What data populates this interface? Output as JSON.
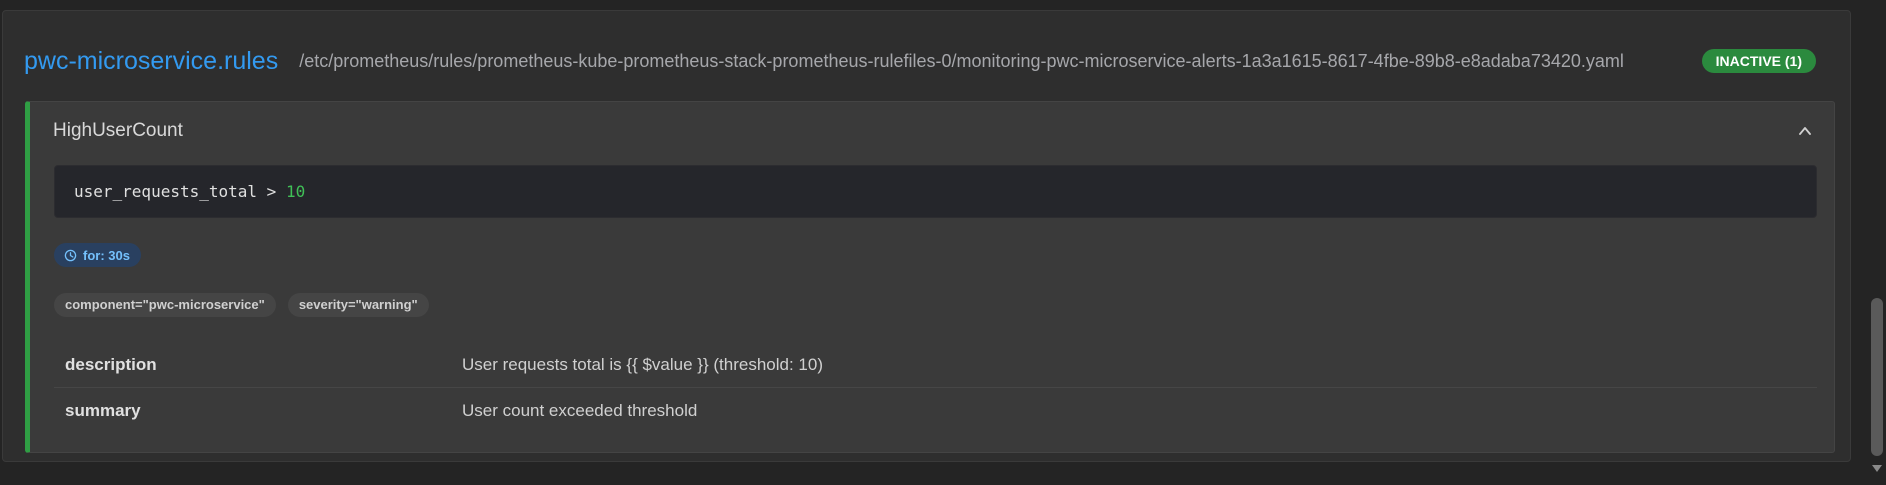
{
  "group": {
    "name": "pwc-microservice.rules",
    "file": "/etc/prometheus/rules/prometheus-kube-prometheus-stack-prometheus-rulefiles-0/monitoring-pwc-microservice-alerts-1a3a1615-8617-4fbe-89b8-e8adaba73420.yaml",
    "state_badge": "INACTIVE (1)",
    "state_color": "#2b8a3e"
  },
  "rule": {
    "name": "HighUserCount",
    "expression": {
      "metric": "user_requests_total",
      "operator": ">",
      "value": "10"
    },
    "for_label": "for: 30s",
    "labels": [
      "component=\"pwc-microservice\"",
      "severity=\"warning\""
    ],
    "annotations": [
      {
        "key": "description",
        "value": "User requests total is {{ $value }} (threshold: 10)"
      },
      {
        "key": "summary",
        "value": "User count exceeded threshold"
      }
    ],
    "accent_color": "#2f9e44"
  },
  "icons": {
    "collapse": "chevron-up-icon",
    "duration": "clock-icon"
  }
}
